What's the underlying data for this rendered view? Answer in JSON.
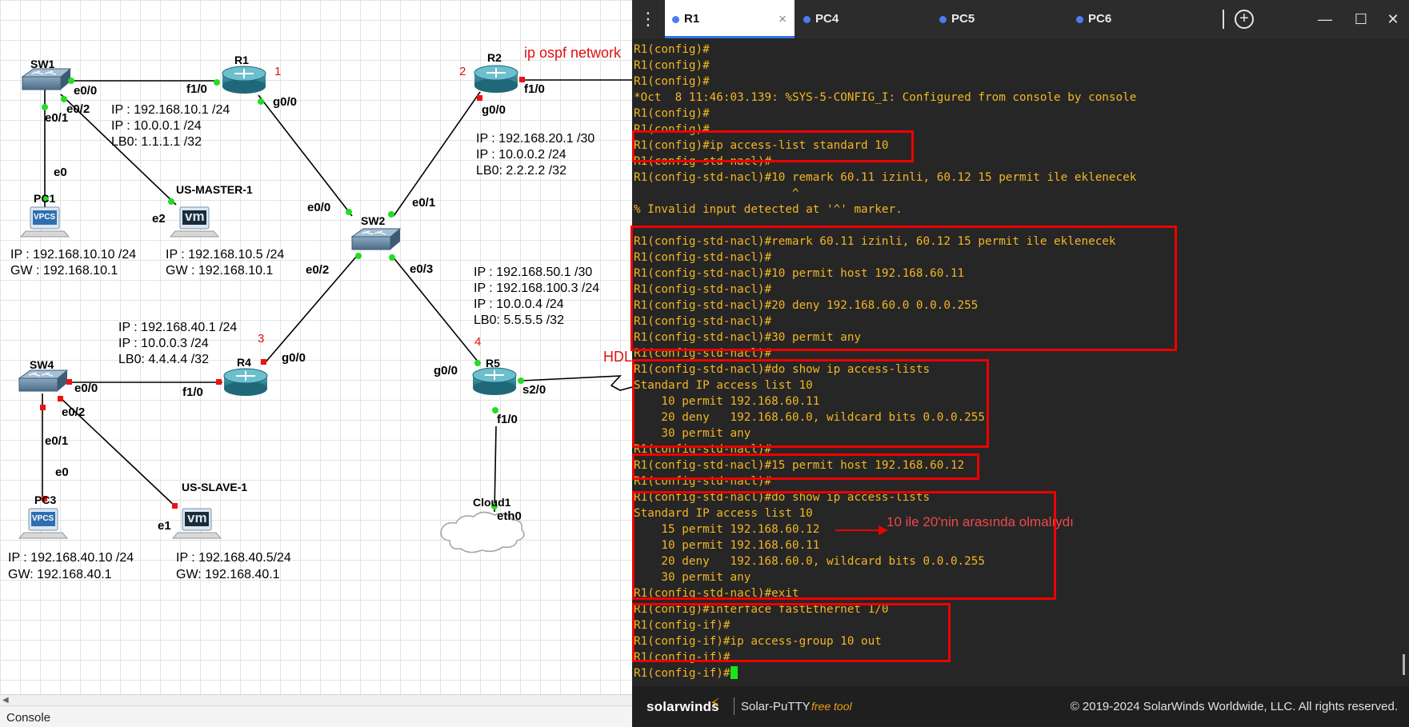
{
  "canvas": {
    "nodes": {
      "sw1": "SW1",
      "r1": "R1",
      "r2": "R2",
      "sw2": "SW2",
      "r4": "R4",
      "r5": "R5",
      "sw4": "SW4",
      "pc1": "PC1",
      "pc3": "PC3",
      "us_master": "US-MASTER-1",
      "us_slave": "US-SLAVE-1",
      "cloud1": "Cloud1"
    },
    "node_icon_text": {
      "vpcs": "VPCS",
      "vm": "vm"
    },
    "numbers": {
      "n1": "1",
      "n2": "2",
      "n3": "3",
      "n4": "4"
    },
    "annotations": {
      "ospf": "ip ospf network",
      "hdlc": "HDL"
    },
    "interfaces": {
      "sw1_e00": "e0/0",
      "sw1_e02": "e0/2",
      "sw1_e01": "e0/1",
      "pc1_e0": "e0",
      "r1_f10": "f1/0",
      "r1_g00": "g0/0",
      "usm_e2": "e2",
      "r2_f10": "f1/0",
      "r2_g00": "g0/0",
      "sw2_e00": "e0/0",
      "sw2_e01": "e0/1",
      "sw2_e02": "e0/2",
      "sw2_e03": "e0/3",
      "r4_g00": "g0/0",
      "r4_f10": "f1/0",
      "sw4_e00": "e0/0",
      "sw4_e02": "e0/2",
      "sw4_e01": "e0/1",
      "pc3_e0": "e0",
      "uss_e1": "e1",
      "r5_g00": "g0/0",
      "r5_s20": "s2/0",
      "r5_f10": "f1/0",
      "cloud_eth0": "eth0"
    },
    "r1_ips": [
      "IP : 192.168.10.1 /24",
      "IP : 10.0.0.1 /24",
      "LB0: 1.1.1.1 /32"
    ],
    "r2_ips": [
      "IP : 192.168.20.1 /30",
      "IP : 10.0.0.2 /24",
      "LB0: 2.2.2.2 /32"
    ],
    "r5_ips": [
      "IP : 192.168.50.1 /30",
      "IP : 192.168.100.3 /24",
      "IP : 10.0.0.4 /24",
      "LB0: 5.5.5.5 /32"
    ],
    "r4_ips": [
      "IP : 192.168.40.1 /24",
      "IP : 10.0.0.3 /24",
      "LB0: 4.4.4.4 /32"
    ],
    "pc1_ips": [
      "IP : 192.168.10.10 /24",
      "GW : 192.168.10.1"
    ],
    "usm_ips": [
      "IP : 192.168.10.5 /24",
      "GW : 192.168.10.1"
    ],
    "pc3_ips": [
      "IP : 192.168.40.10 /24",
      "GW: 192.168.40.1"
    ],
    "uss_ips": [
      "IP : 192.168.40.5/24",
      "GW: 192.168.40.1"
    ]
  },
  "console_label": "Console",
  "putty": {
    "tabs": [
      {
        "label": "R1",
        "active": true
      },
      {
        "label": "PC4",
        "active": false
      },
      {
        "label": "PC5",
        "active": false
      },
      {
        "label": "PC6",
        "active": false
      }
    ],
    "tab_close": "×",
    "menu_icon": "⋮",
    "add_icon": "+",
    "window_controls": {
      "minimize": "—",
      "maximize": "☐",
      "close": "✕"
    },
    "terminal_lines": [
      "R1(config)#",
      "R1(config)#",
      "R1(config)#",
      "*Oct  8 11:46:03.139: %SYS-5-CONFIG_I: Configured from console by console",
      "R1(config)#",
      "R1(config)#",
      "R1(config)#ip access-list standard 10",
      "R1(config-std-nacl)#",
      "R1(config-std-nacl)#10 remark 60.11 izinli, 60.12 15 permit ile eklenecek",
      "                       ^",
      "% Invalid input detected at '^' marker.",
      "",
      "R1(config-std-nacl)#remark 60.11 izinli, 60.12 15 permit ile eklenecek",
      "R1(config-std-nacl)#",
      "R1(config-std-nacl)#10 permit host 192.168.60.11",
      "R1(config-std-nacl)#",
      "R1(config-std-nacl)#20 deny 192.168.60.0 0.0.0.255",
      "R1(config-std-nacl)#",
      "R1(config-std-nacl)#30 permit any",
      "R1(config-std-nacl)#",
      "R1(config-std-nacl)#do show ip access-lists",
      "Standard IP access list 10",
      "    10 permit 192.168.60.11",
      "    20 deny   192.168.60.0, wildcard bits 0.0.0.255",
      "    30 permit any",
      "R1(config-std-nacl)#",
      "R1(config-std-nacl)#15 permit host 192.168.60.12",
      "R1(config-std-nacl)#",
      "R1(config-std-nacl)#do show ip access-lists",
      "Standard IP access list 10",
      "    15 permit 192.168.60.12",
      "    10 permit 192.168.60.11",
      "    20 deny   192.168.60.0, wildcard bits 0.0.0.255",
      "    30 permit any",
      "R1(config-std-nacl)#exit",
      "R1(config)#interface fastEthernet 1/0",
      "R1(config-if)#",
      "R1(config-if)#ip access-group 10 out",
      "R1(config-if)#",
      "R1(config-if)#"
    ],
    "annotation_note": "10 ile 20'nin arasında olmalıydı",
    "status": {
      "logo": "solarwinds",
      "product": "Solar-PuTTY",
      "free_tool": "free tool",
      "copyright": "© 2019-2024 SolarWinds Worldwide, LLC. All rights reserved."
    }
  },
  "colors": {
    "terminal_text": "#f3b624",
    "annotation_red": "#ee0000",
    "link_up": "#22dd22",
    "link_down": "#ee1111",
    "tab_accent": "#2f72e6"
  }
}
